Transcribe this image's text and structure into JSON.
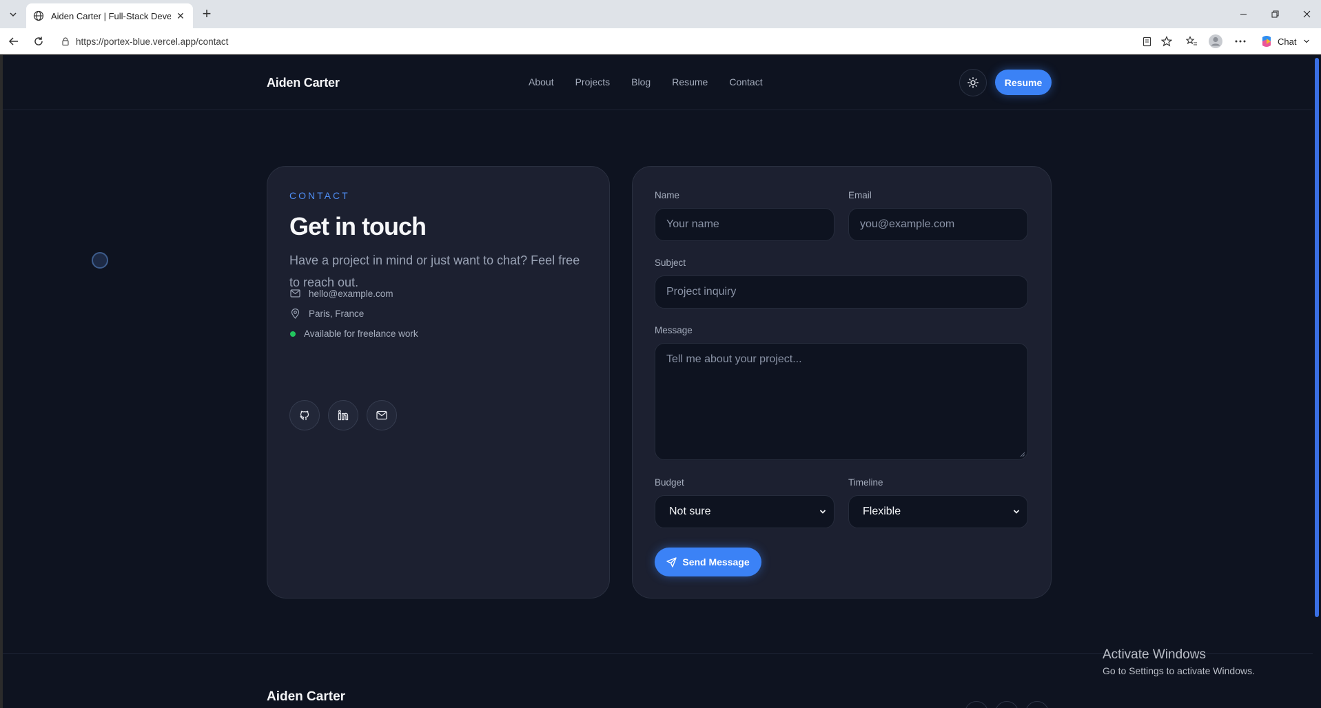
{
  "browser": {
    "tab_title": "Aiden Carter | Full-Stack Develope",
    "url": "https://portex-blue.vercel.app/contact",
    "chat_label": "Chat"
  },
  "header": {
    "brand": "Aiden Carter",
    "nav": [
      "About",
      "Projects",
      "Blog",
      "Resume",
      "Contact"
    ],
    "resume_button": "Resume"
  },
  "contact_info": {
    "eyebrow": "CONTACT",
    "headline": "Get in touch",
    "intro": "Have a project in mind or just want to chat? Feel free to reach out.",
    "email": "hello@example.com",
    "location": "Paris, France",
    "availability": "Available for freelance work",
    "socials": [
      "github-icon",
      "linkedin-icon",
      "mail-icon"
    ]
  },
  "form": {
    "name_label": "Name",
    "name_placeholder": "Your name",
    "email_label": "Email",
    "email_placeholder": "you@example.com",
    "subject_label": "Subject",
    "subject_placeholder": "Project inquiry",
    "message_label": "Message",
    "message_placeholder": "Tell me about your project...",
    "budget_label": "Budget",
    "budget_value": "Not sure",
    "timeline_label": "Timeline",
    "timeline_value": "Flexible",
    "send_button": "Send Message"
  },
  "footer": {
    "brand": "Aiden Carter"
  },
  "watermark": {
    "title": "Activate Windows",
    "subtitle": "Go to Settings to activate Windows."
  },
  "colors": {
    "accent": "#3b82f6",
    "background": "#0e1320",
    "card": "#1c2030",
    "status_green": "#22c55e"
  }
}
